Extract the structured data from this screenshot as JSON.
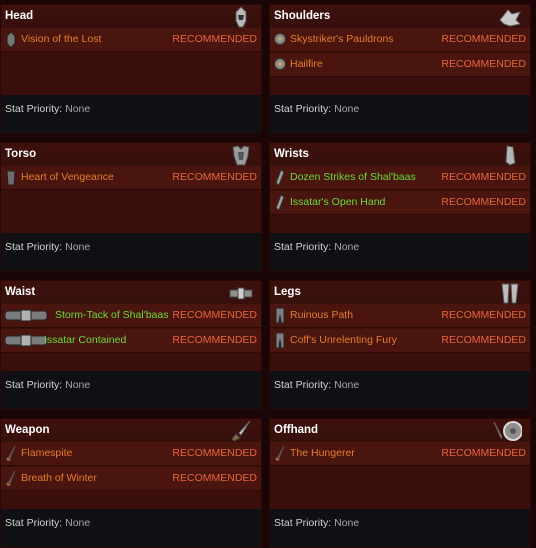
{
  "colors": {
    "legendary": "#e67e2c",
    "set": "#6adb3a",
    "recommended": "#e8663c",
    "title": "#ffffff"
  },
  "stat_label": "Stat Priority:",
  "stat_value": "None",
  "recommended_label": "RECOMMENDED",
  "panels": [
    {
      "title": "Head",
      "icon": "helmet-icon",
      "items": [
        {
          "name": "Vision of the Lost",
          "rarity": "legendary",
          "icon": "helmet-item-icon"
        }
      ]
    },
    {
      "title": "Shoulders",
      "icon": "shoulder-armor-icon",
      "items": [
        {
          "name": "Skystriker's Pauldrons",
          "rarity": "legendary",
          "icon": "pauldron-item-icon"
        },
        {
          "name": "Hailfire",
          "rarity": "legendary",
          "icon": "pauldron-item-icon"
        }
      ]
    },
    {
      "title": "Torso",
      "icon": "chest-armor-icon",
      "items": [
        {
          "name": "Heart of Vengeance",
          "rarity": "legendary",
          "icon": "chest-item-icon"
        }
      ]
    },
    {
      "title": "Wrists",
      "icon": "bracer-icon",
      "items": [
        {
          "name": "Dozen Strikes of Shal'baas",
          "rarity": "set",
          "icon": "bracer-item-icon"
        },
        {
          "name": "Issatar's Open Hand",
          "rarity": "set",
          "icon": "bracer-item-icon"
        }
      ]
    },
    {
      "title": "Waist",
      "icon": "belt-icon",
      "items": [
        {
          "name": "Storm-Tack of Shal'baas",
          "rarity": "set",
          "icon": "belt-item-icon"
        },
        {
          "name": "Issatar Contained",
          "rarity": "set",
          "icon": "belt-item-icon"
        }
      ]
    },
    {
      "title": "Legs",
      "icon": "legs-armor-icon",
      "items": [
        {
          "name": "Ruinous Path",
          "rarity": "legendary",
          "icon": "legs-item-icon"
        },
        {
          "name": "Coff's Unrelenting Fury",
          "rarity": "legendary",
          "icon": "legs-item-icon"
        }
      ]
    },
    {
      "title": "Weapon",
      "icon": "dagger-icon",
      "items": [
        {
          "name": "Flamespite",
          "rarity": "legendary",
          "icon": "dagger-item-icon"
        },
        {
          "name": "Breath of Winter",
          "rarity": "legendary",
          "icon": "dagger-item-icon"
        }
      ]
    },
    {
      "title": "Offhand",
      "icon": "sword-and-shield-icon",
      "items": [
        {
          "name": "The Hungerer",
          "rarity": "legendary",
          "icon": "dagger-item-icon"
        }
      ]
    }
  ]
}
